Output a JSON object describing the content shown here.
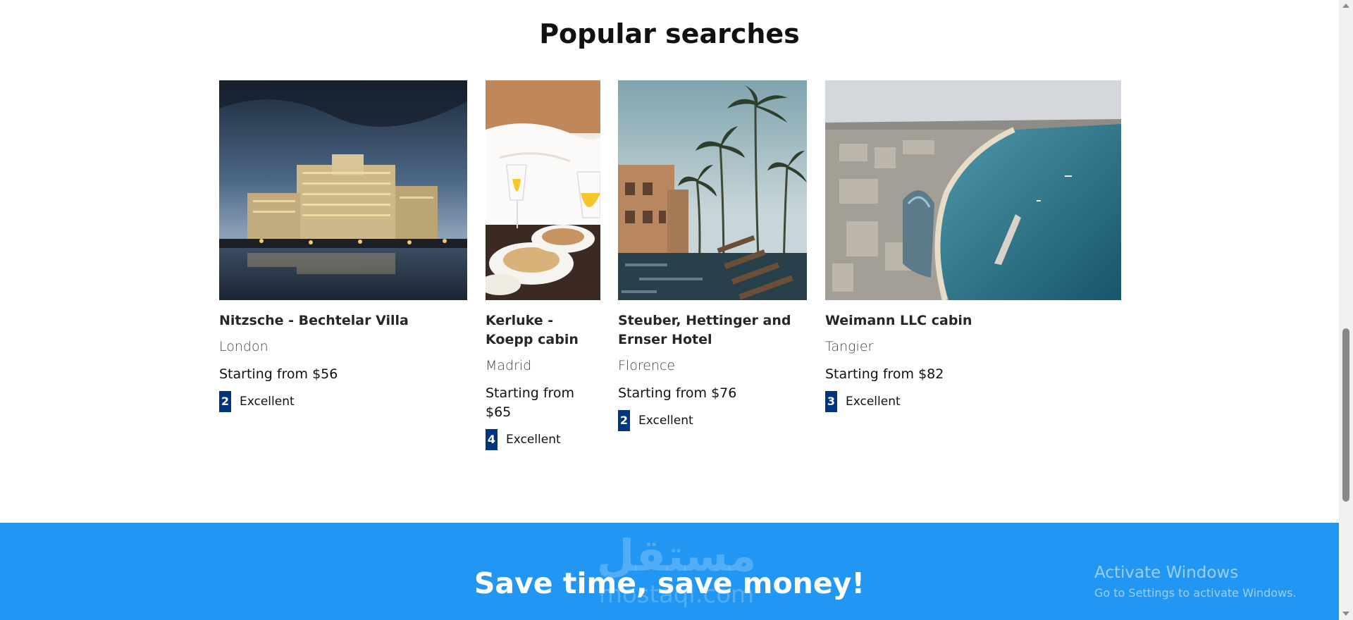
{
  "section": {
    "title": "Popular searches"
  },
  "cards": [
    {
      "name": "Nitzsche - Bechtelar Villa",
      "city": "London",
      "price": "Starting from $56",
      "score": "2",
      "score_label": "Excellent",
      "image": "hotel-night-lake"
    },
    {
      "name": "Kerluke - Koepp cabin",
      "city": "Madrid",
      "price": "Starting from $65",
      "score": "4",
      "score_label": "Excellent",
      "image": "breakfast-wine"
    },
    {
      "name": "Steuber, Hettinger and Ernser Hotel",
      "city": "Florence",
      "price": "Starting from $76",
      "score": "2",
      "score_label": "Excellent",
      "image": "palm-pool-resort"
    },
    {
      "name": "Weimann LLC cabin",
      "city": "Tangier",
      "price": "Starting from $82",
      "score": "3",
      "score_label": "Excellent",
      "image": "coastal-city-aerial"
    }
  ],
  "banner": {
    "title": "Save time, save money!",
    "watermark": "مستقل",
    "watermark_sub": "mostaql.com",
    "background": "#2196f3"
  },
  "windows_notice": {
    "title": "Activate Windows",
    "subtitle": "Go to Settings to activate Windows."
  },
  "colors": {
    "score_badge": "#003580",
    "banner": "#2196f3"
  }
}
